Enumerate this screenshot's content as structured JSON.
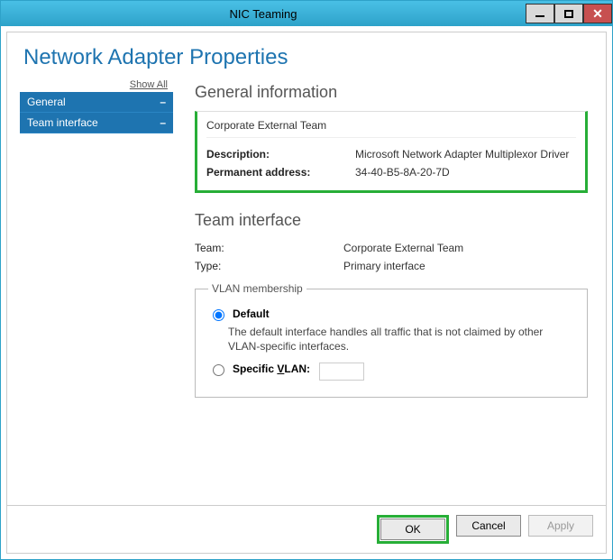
{
  "window": {
    "title": "NIC Teaming"
  },
  "header": {
    "title": "Network Adapter Properties"
  },
  "sidebar": {
    "show_all": "Show All",
    "items": [
      {
        "label": "General"
      },
      {
        "label": "Team interface"
      }
    ]
  },
  "general": {
    "section_title": "General information",
    "name": "Corporate External Team",
    "rows": {
      "description_label": "Description:",
      "description_value": "Microsoft Network Adapter Multiplexor Driver",
      "perm_addr_label": "Permanent address:",
      "perm_addr_value": "34-40-B5-8A-20-7D"
    }
  },
  "team_interface": {
    "section_title": "Team interface",
    "team_label": "Team:",
    "team_value": "Corporate External Team",
    "type_label": "Type:",
    "type_value": "Primary interface"
  },
  "vlan": {
    "legend": "VLAN membership",
    "default_label": "Default",
    "default_desc": "The default interface handles all traffic that is not claimed by other VLAN-specific interfaces.",
    "specific_prefix": "Specific ",
    "specific_vlan_letter": "V",
    "specific_suffix": "LAN:",
    "selected": "default",
    "specific_value": ""
  },
  "footer": {
    "ok": "OK",
    "cancel": "Cancel",
    "apply": "Apply"
  }
}
